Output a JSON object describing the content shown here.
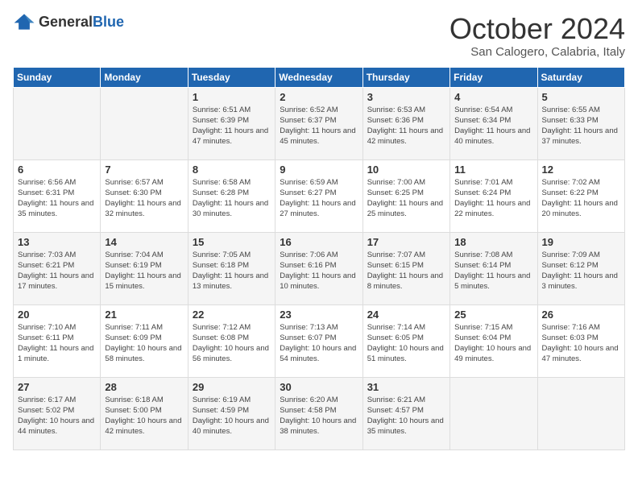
{
  "header": {
    "logo_general": "General",
    "logo_blue": "Blue",
    "month": "October 2024",
    "location": "San Calogero, Calabria, Italy"
  },
  "days_of_week": [
    "Sunday",
    "Monday",
    "Tuesday",
    "Wednesday",
    "Thursday",
    "Friday",
    "Saturday"
  ],
  "weeks": [
    [
      {
        "day": "",
        "info": ""
      },
      {
        "day": "",
        "info": ""
      },
      {
        "day": "1",
        "info": "Sunrise: 6:51 AM\nSunset: 6:39 PM\nDaylight: 11 hours and 47 minutes."
      },
      {
        "day": "2",
        "info": "Sunrise: 6:52 AM\nSunset: 6:37 PM\nDaylight: 11 hours and 45 minutes."
      },
      {
        "day": "3",
        "info": "Sunrise: 6:53 AM\nSunset: 6:36 PM\nDaylight: 11 hours and 42 minutes."
      },
      {
        "day": "4",
        "info": "Sunrise: 6:54 AM\nSunset: 6:34 PM\nDaylight: 11 hours and 40 minutes."
      },
      {
        "day": "5",
        "info": "Sunrise: 6:55 AM\nSunset: 6:33 PM\nDaylight: 11 hours and 37 minutes."
      }
    ],
    [
      {
        "day": "6",
        "info": "Sunrise: 6:56 AM\nSunset: 6:31 PM\nDaylight: 11 hours and 35 minutes."
      },
      {
        "day": "7",
        "info": "Sunrise: 6:57 AM\nSunset: 6:30 PM\nDaylight: 11 hours and 32 minutes."
      },
      {
        "day": "8",
        "info": "Sunrise: 6:58 AM\nSunset: 6:28 PM\nDaylight: 11 hours and 30 minutes."
      },
      {
        "day": "9",
        "info": "Sunrise: 6:59 AM\nSunset: 6:27 PM\nDaylight: 11 hours and 27 minutes."
      },
      {
        "day": "10",
        "info": "Sunrise: 7:00 AM\nSunset: 6:25 PM\nDaylight: 11 hours and 25 minutes."
      },
      {
        "day": "11",
        "info": "Sunrise: 7:01 AM\nSunset: 6:24 PM\nDaylight: 11 hours and 22 minutes."
      },
      {
        "day": "12",
        "info": "Sunrise: 7:02 AM\nSunset: 6:22 PM\nDaylight: 11 hours and 20 minutes."
      }
    ],
    [
      {
        "day": "13",
        "info": "Sunrise: 7:03 AM\nSunset: 6:21 PM\nDaylight: 11 hours and 17 minutes."
      },
      {
        "day": "14",
        "info": "Sunrise: 7:04 AM\nSunset: 6:19 PM\nDaylight: 11 hours and 15 minutes."
      },
      {
        "day": "15",
        "info": "Sunrise: 7:05 AM\nSunset: 6:18 PM\nDaylight: 11 hours and 13 minutes."
      },
      {
        "day": "16",
        "info": "Sunrise: 7:06 AM\nSunset: 6:16 PM\nDaylight: 11 hours and 10 minutes."
      },
      {
        "day": "17",
        "info": "Sunrise: 7:07 AM\nSunset: 6:15 PM\nDaylight: 11 hours and 8 minutes."
      },
      {
        "day": "18",
        "info": "Sunrise: 7:08 AM\nSunset: 6:14 PM\nDaylight: 11 hours and 5 minutes."
      },
      {
        "day": "19",
        "info": "Sunrise: 7:09 AM\nSunset: 6:12 PM\nDaylight: 11 hours and 3 minutes."
      }
    ],
    [
      {
        "day": "20",
        "info": "Sunrise: 7:10 AM\nSunset: 6:11 PM\nDaylight: 11 hours and 1 minute."
      },
      {
        "day": "21",
        "info": "Sunrise: 7:11 AM\nSunset: 6:09 PM\nDaylight: 10 hours and 58 minutes."
      },
      {
        "day": "22",
        "info": "Sunrise: 7:12 AM\nSunset: 6:08 PM\nDaylight: 10 hours and 56 minutes."
      },
      {
        "day": "23",
        "info": "Sunrise: 7:13 AM\nSunset: 6:07 PM\nDaylight: 10 hours and 54 minutes."
      },
      {
        "day": "24",
        "info": "Sunrise: 7:14 AM\nSunset: 6:05 PM\nDaylight: 10 hours and 51 minutes."
      },
      {
        "day": "25",
        "info": "Sunrise: 7:15 AM\nSunset: 6:04 PM\nDaylight: 10 hours and 49 minutes."
      },
      {
        "day": "26",
        "info": "Sunrise: 7:16 AM\nSunset: 6:03 PM\nDaylight: 10 hours and 47 minutes."
      }
    ],
    [
      {
        "day": "27",
        "info": "Sunrise: 6:17 AM\nSunset: 5:02 PM\nDaylight: 10 hours and 44 minutes."
      },
      {
        "day": "28",
        "info": "Sunrise: 6:18 AM\nSunset: 5:00 PM\nDaylight: 10 hours and 42 minutes."
      },
      {
        "day": "29",
        "info": "Sunrise: 6:19 AM\nSunset: 4:59 PM\nDaylight: 10 hours and 40 minutes."
      },
      {
        "day": "30",
        "info": "Sunrise: 6:20 AM\nSunset: 4:58 PM\nDaylight: 10 hours and 38 minutes."
      },
      {
        "day": "31",
        "info": "Sunrise: 6:21 AM\nSunset: 4:57 PM\nDaylight: 10 hours and 35 minutes."
      },
      {
        "day": "",
        "info": ""
      },
      {
        "day": "",
        "info": ""
      }
    ]
  ]
}
